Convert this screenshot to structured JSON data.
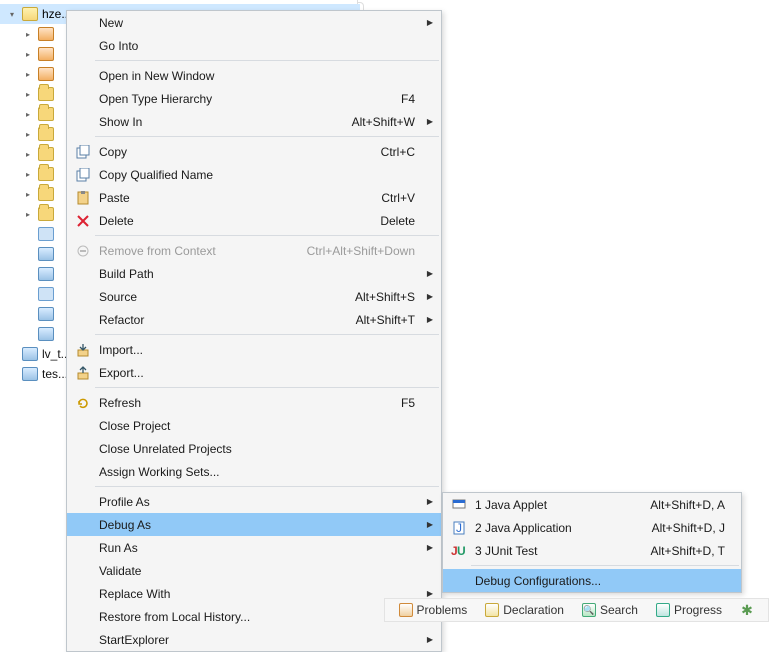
{
  "tree": {
    "root_label": "hze...",
    "bottom1": "lv_t...",
    "bottom2": "tes..."
  },
  "menu": {
    "new": "New",
    "go_into": "Go Into",
    "open_new_window": "Open in New Window",
    "open_type_hierarchy": "Open Type Hierarchy",
    "open_type_hierarchy_key": "F4",
    "show_in": "Show In",
    "show_in_key": "Alt+Shift+W",
    "copy": "Copy",
    "copy_key": "Ctrl+C",
    "copy_qualified": "Copy Qualified Name",
    "paste": "Paste",
    "paste_key": "Ctrl+V",
    "delete": "Delete",
    "delete_key": "Delete",
    "remove_context": "Remove from Context",
    "remove_context_key": "Ctrl+Alt+Shift+Down",
    "build_path": "Build Path",
    "source": "Source",
    "source_key": "Alt+Shift+S",
    "refactor": "Refactor",
    "refactor_key": "Alt+Shift+T",
    "import": "Import...",
    "export": "Export...",
    "refresh": "Refresh",
    "refresh_key": "F5",
    "close_project": "Close Project",
    "close_unrelated": "Close Unrelated Projects",
    "assign_ws": "Assign Working Sets...",
    "profile_as": "Profile As",
    "debug_as": "Debug As",
    "run_as": "Run As",
    "validate": "Validate",
    "replace_with": "Replace With",
    "restore_history": "Restore from Local History...",
    "start_explorer": "StartExplorer"
  },
  "submenu": {
    "applet": "1 Java Applet",
    "applet_key": "Alt+Shift+D, A",
    "app": "2 Java Application",
    "app_key": "Alt+Shift+D, J",
    "junit": "3 JUnit Test",
    "junit_key": "Alt+Shift+D, T",
    "debug_conf": "Debug Configurations..."
  },
  "tabs": {
    "problems": "Problems",
    "declaration": "Declaration",
    "search": "Search",
    "progress": "Progress"
  }
}
